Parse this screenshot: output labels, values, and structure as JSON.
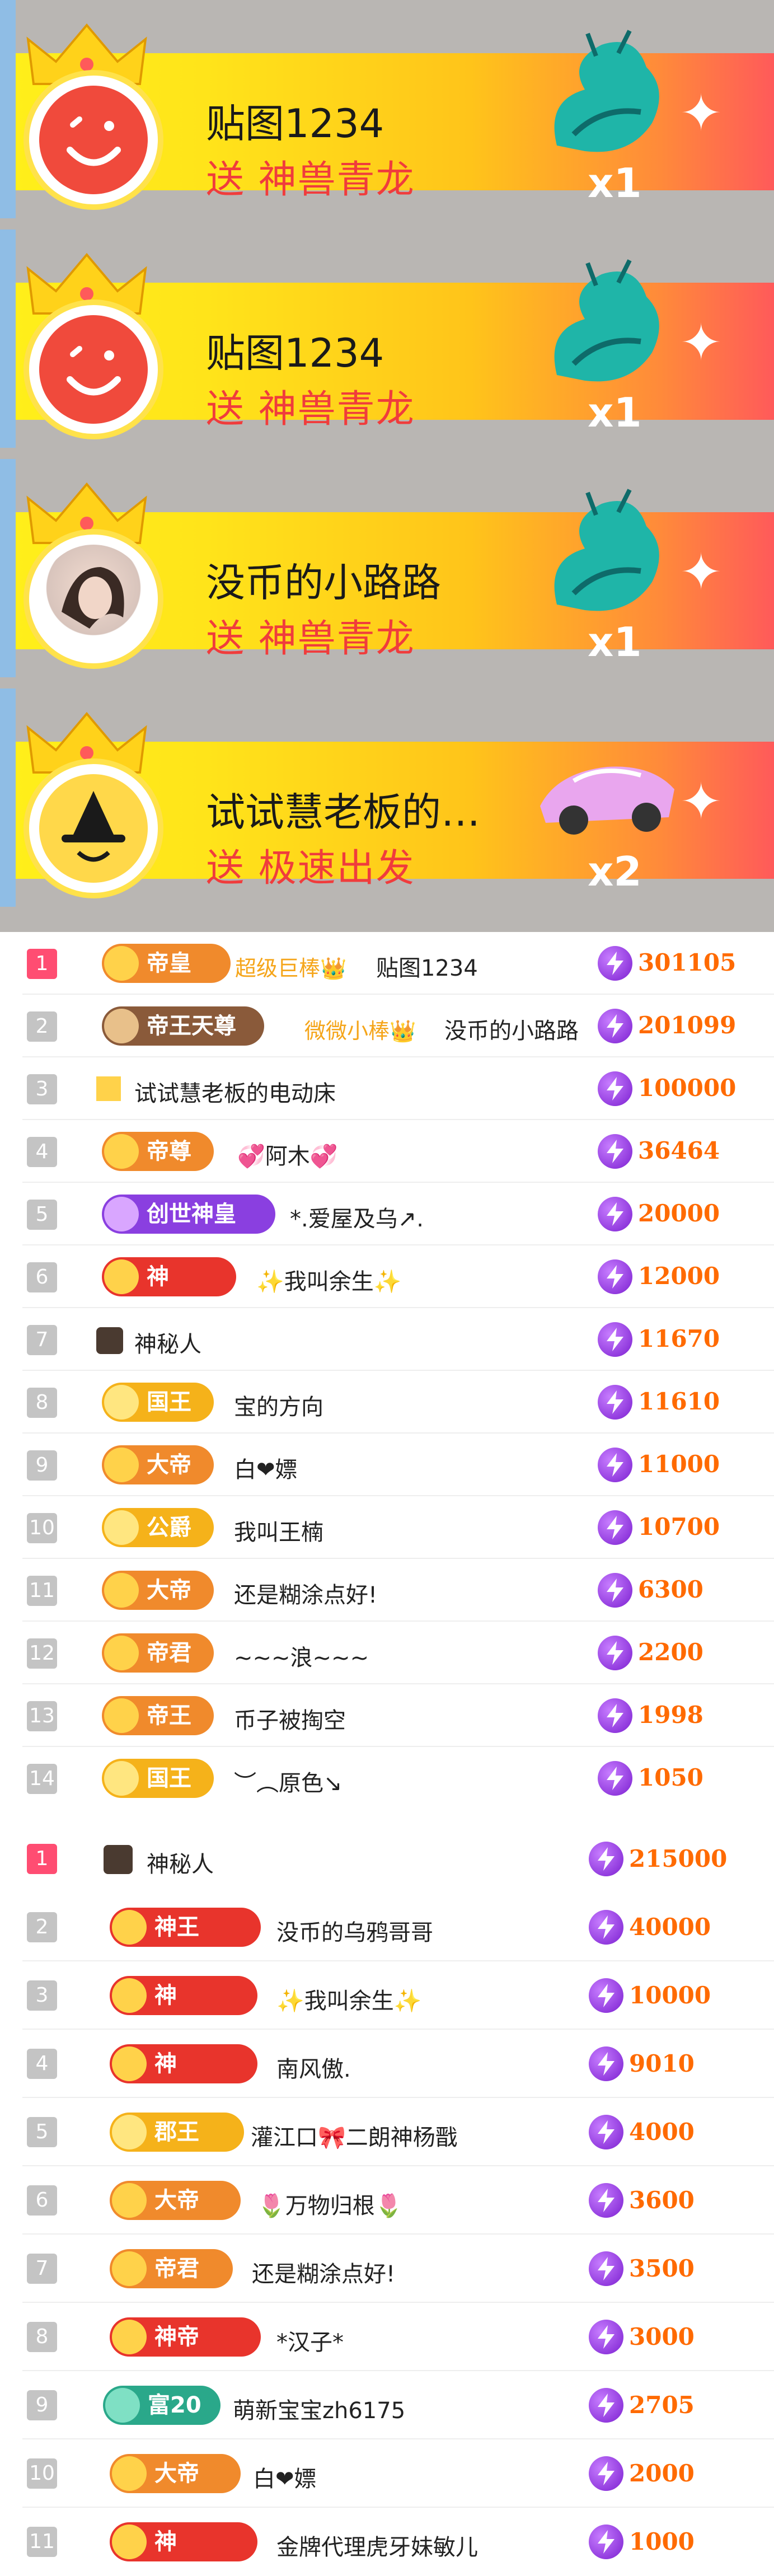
{
  "banners": [
    {
      "sender": "贴图1234",
      "gift_line": "送 神兽青龙",
      "count": "x1",
      "avatar": "smiley-avatar"
    },
    {
      "sender": "贴图1234",
      "gift_line": "送 神兽青龙",
      "count": "x1",
      "avatar": "smiley-avatar"
    },
    {
      "sender": "没币的小路路",
      "gift_line": "送 神兽青龙",
      "count": "x1",
      "avatar": "photo-avatar"
    },
    {
      "sender": "试试慧老板的…",
      "gift_line": "送 极速出发",
      "count": "x2",
      "avatar": "witch-avatar"
    }
  ],
  "list1": [
    {
      "rank": "1",
      "badge": "帝皇",
      "prefix": "超级巨棒👑",
      "name": "贴图1234",
      "score": "301105"
    },
    {
      "rank": "2",
      "badge": "帝王天尊",
      "prefix": "微微小棒👑",
      "name": "没币的小路路",
      "score": "201099"
    },
    {
      "rank": "3",
      "badge": "",
      "prefix": "",
      "name": "试试慧老板的电动床",
      "score": "100000"
    },
    {
      "rank": "4",
      "badge": "帝尊",
      "prefix": "",
      "name": "💞阿木💞",
      "score": "36464"
    },
    {
      "rank": "5",
      "badge": "创世神皇",
      "prefix": "",
      "name": "*.爱屋及乌↗.",
      "score": "20000"
    },
    {
      "rank": "6",
      "badge": "神",
      "prefix": "",
      "name": "✨我叫余生✨",
      "score": "12000"
    },
    {
      "rank": "7",
      "badge": "",
      "prefix": "",
      "name": "神秘人",
      "score": "11670"
    },
    {
      "rank": "8",
      "badge": "国王",
      "prefix": "",
      "name": "宝的方向",
      "score": "11610"
    },
    {
      "rank": "9",
      "badge": "大帝",
      "prefix": "",
      "name": "白❤嫖",
      "score": "11000"
    },
    {
      "rank": "10",
      "badge": "公爵",
      "prefix": "",
      "name": "我叫王楠",
      "score": "10700"
    },
    {
      "rank": "11",
      "badge": "大帝",
      "prefix": "",
      "name": "还是糊涂点好!",
      "score": "6300"
    },
    {
      "rank": "12",
      "badge": "帝君",
      "prefix": "",
      "name": "~~~浪~~~",
      "score": "2200"
    },
    {
      "rank": "13",
      "badge": "帝王",
      "prefix": "",
      "name": "币子被掏空",
      "score": "1998"
    },
    {
      "rank": "14",
      "badge": "国王",
      "prefix": "",
      "name": "︶︵原色↘",
      "score": "1050"
    }
  ],
  "list2": [
    {
      "rank": "1",
      "badge": "",
      "name": "神秘人",
      "score": "215000"
    },
    {
      "rank": "2",
      "badge": "神王",
      "name": "没币的乌鸦哥哥",
      "score": "40000"
    },
    {
      "rank": "3",
      "badge": "神",
      "name": "✨我叫余生✨",
      "score": "10000"
    },
    {
      "rank": "4",
      "badge": "神",
      "name": "南风傲.",
      "score": "9010"
    },
    {
      "rank": "5",
      "badge": "郡王",
      "name": "灌江口🎀二朗神杨戬",
      "score": "4000"
    },
    {
      "rank": "6",
      "badge": "大帝",
      "name": "🌷万物归根🌷",
      "score": "3600"
    },
    {
      "rank": "7",
      "badge": "帝君",
      "name": "还是糊涂点好!",
      "score": "3500"
    },
    {
      "rank": "8",
      "badge": "神帝",
      "name": "*汉子*",
      "score": "3000"
    },
    {
      "rank": "9",
      "badge": "富20",
      "name": "萌新宝宝zh6175",
      "score": "2705"
    },
    {
      "rank": "10",
      "badge": "大帝",
      "name": "白❤嫖",
      "score": "2000"
    },
    {
      "rank": "11",
      "badge": "神",
      "name": "金牌代理虎牙妹敏儿",
      "score": "1000"
    }
  ],
  "colors": {
    "rank_top": "#ff4d72",
    "rank_other": "#c4c4c4",
    "score": "#ff6a00",
    "coin": "#8a2be2",
    "gift_text": "#f03c3c",
    "badge_red": "#e8342c",
    "badge_orange": "#f08a2c",
    "badge_gold": "#f5b21a",
    "badge_purple": "#8a3fe0",
    "badge_brown": "#8a5a3a",
    "badge_teal": "#2aa88a"
  }
}
